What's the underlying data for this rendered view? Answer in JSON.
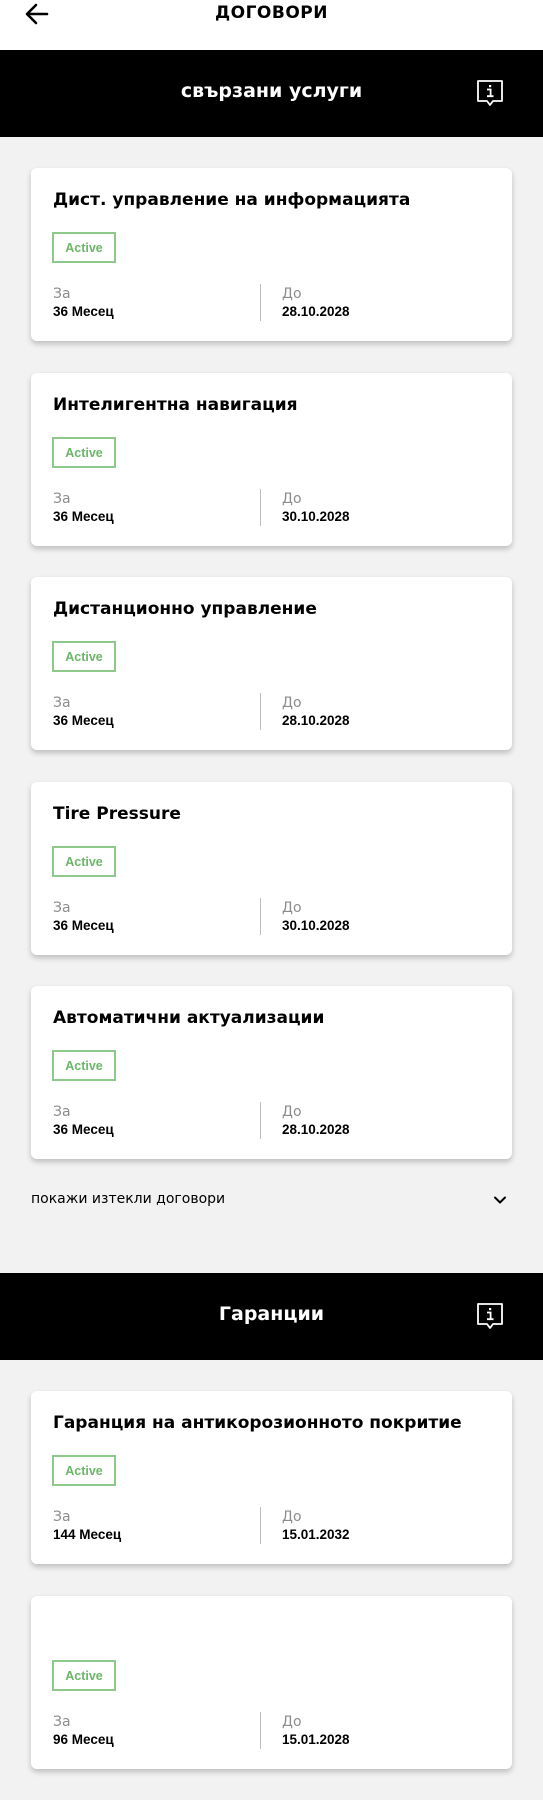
{
  "header": {
    "title": "ДОГОВОРИ"
  },
  "sections": [
    {
      "title": "свързани услуги",
      "cards": [
        {
          "title": "Дист. управление на информацията",
          "status": "Active",
          "duration_label": "За",
          "duration": "36 Месец",
          "until_label": "До",
          "until": "28.10.2028"
        },
        {
          "title": "Интелигентна навигация",
          "status": "Active",
          "duration_label": "За",
          "duration": "36 Месец",
          "until_label": "До",
          "until": "30.10.2028"
        },
        {
          "title": "Дистанционно управление",
          "status": "Active",
          "duration_label": "За",
          "duration": "36 Месец",
          "until_label": "До",
          "until": "28.10.2028"
        },
        {
          "title": "Tire Pressure",
          "status": "Active",
          "duration_label": "За",
          "duration": "36 Месец",
          "until_label": "До",
          "until": "30.10.2028"
        },
        {
          "title": "Автоматични актуализации",
          "status": "Active",
          "duration_label": "За",
          "duration": "36 Месец",
          "until_label": "До",
          "until": "28.10.2028"
        }
      ],
      "expired_toggle": "покажи изтекли договори"
    },
    {
      "title": "Гаранции",
      "cards": [
        {
          "title": "Гаранция на антикорозионното покритие",
          "status": "Active",
          "duration_label": "За",
          "duration": "144 Месец",
          "until_label": "До",
          "until": "15.01.2032"
        },
        {
          "title": "",
          "status": "Active",
          "duration_label": "За",
          "duration": "96 Месец",
          "until_label": "До",
          "until": "15.01.2028"
        }
      ]
    }
  ],
  "icons": {
    "back": "arrow-left-icon",
    "info": "info-speech-bubble-icon",
    "expand": "chevron-down-icon"
  },
  "colors": {
    "header_bg": "#000000",
    "active_badge": "#6bb668",
    "page_bg": "#f2f2f2"
  }
}
